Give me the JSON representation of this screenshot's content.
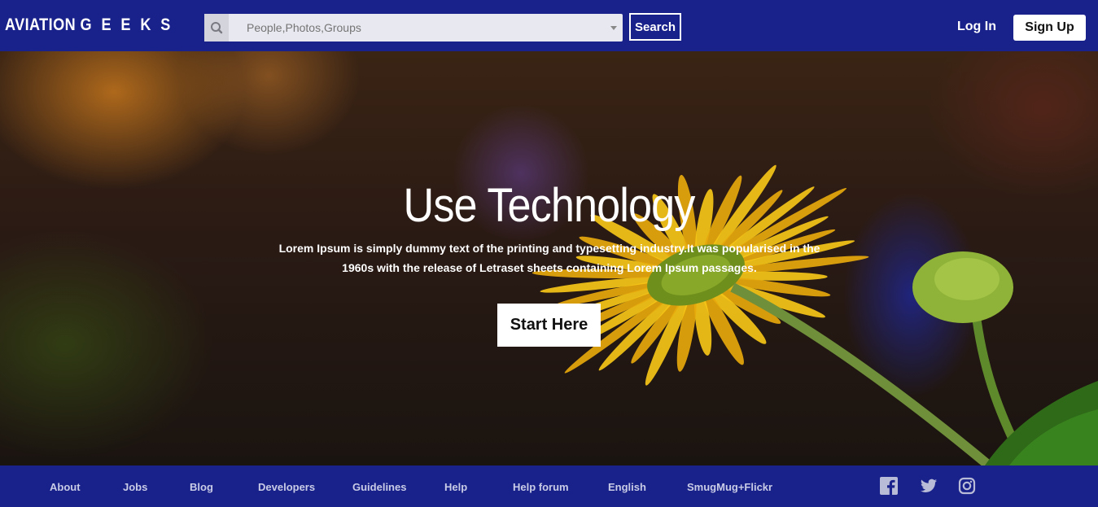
{
  "header": {
    "logo_main": "AVIATION",
    "logo_sub": "G E E K S",
    "search": {
      "placeholder": "People,Photos,Groups"
    },
    "search_button": "Search",
    "login": "Log In",
    "signup": "Sign Up"
  },
  "hero": {
    "title": "Use Technology",
    "text": "Lorem Ipsum is simply dummy text of the printing and typesetting industry.It was popularised in the 1960s with the release of Letraset sheets containing Lorem Ipsum passages.",
    "cta": "Start Here"
  },
  "footer": {
    "links": [
      "About",
      "Jobs",
      "Blog",
      "Developers",
      "Guidelines",
      "Help",
      "Help forum",
      "English",
      "SmugMug+Flickr"
    ],
    "social": [
      "facebook-icon",
      "twitter-icon",
      "instagram-icon"
    ]
  },
  "colors": {
    "brand": "#19218a",
    "footer_link": "#c9cce6",
    "flower": "#f5c518"
  }
}
